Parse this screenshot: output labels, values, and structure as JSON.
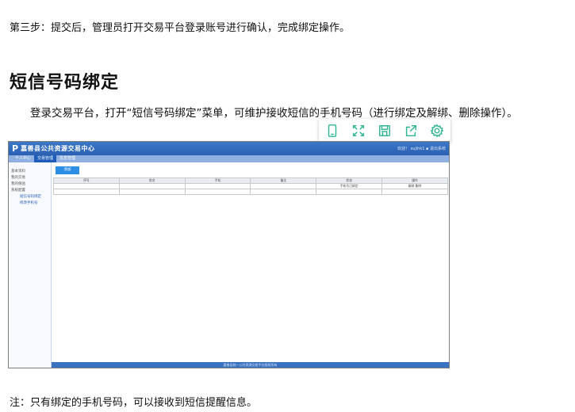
{
  "doc": {
    "step3": "第三步：提交后，管理员打开交易平台登录账号进行确认，完成绑定操作。",
    "section_title": "短信号码绑定",
    "description": "登录交易平台，打开“短信号码绑定”菜单，可维护接收短信的手机号码（进行绑定及解绑、删除操作）。",
    "note": "注：只有绑定的手机号码，可以接收到短信提醒信息。"
  },
  "toolbar": {
    "icons": [
      "phone-icon",
      "fullscreen-icon",
      "save-icon",
      "share-icon",
      "settings-icon"
    ]
  },
  "screenshot": {
    "logo": "P",
    "app_title": "嘉善县公共资源交易中心",
    "user_info": "欢迎！ sujihk1 ▪ 退出系统",
    "nav_tabs": [
      "个人中心",
      "交易管理",
      "信息管理"
    ],
    "sidebar": [
      "基本资料",
      "我的交易",
      "我的保函",
      "系统配置"
    ],
    "sidebar_sub": [
      "短信号码绑定",
      "修改手机号"
    ],
    "add_button": "添加",
    "table_headers": [
      "序号",
      "姓名",
      "手机",
      "备注",
      "状态",
      "操作"
    ],
    "table_row": [
      "",
      "",
      "",
      "",
      "手机号已绑定",
      "解绑 删除"
    ],
    "footer": "嘉善县统一公共资源交易平台版权所有"
  },
  "colors": {
    "toolbar_icon": "#2fb593",
    "header_blue": "#2a60b2"
  }
}
